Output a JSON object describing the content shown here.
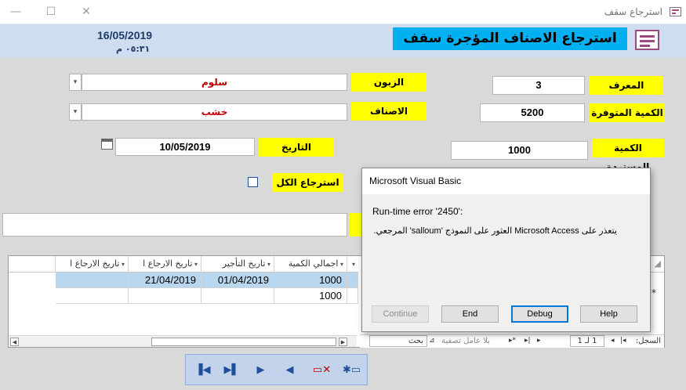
{
  "window": {
    "title": "استرجاع سقف",
    "minimize": "—",
    "maximize": "☐",
    "close": "✕"
  },
  "header": {
    "date": "16/05/2019",
    "time": "٠٥:٣١ م",
    "title": "استرجاع الاصناف المؤجرة سقف"
  },
  "form": {
    "id_label": "المعرف",
    "id_value": "3",
    "available_label": "الكمية المتوفرة",
    "available_value": "5200",
    "returned_label": "الكمية المستردة",
    "returned_value": "1000",
    "customer_label": "الزبون",
    "customer_value": "سلوم",
    "items_label": "الاصناف",
    "items_value": "خشب",
    "date_label": "التاريخ",
    "date_value": "10/05/2019",
    "return_all_label": "استرجاع الكل"
  },
  "sheet": {
    "headers": [
      "تاريخ الارجاع ا",
      "تاريخ الارجاع ا",
      "تاريخ التأجير",
      "اجمالي الكمية"
    ],
    "rows": [
      {
        "c1": "",
        "c2": "21/04/2019",
        "c3": "01/04/2019",
        "c4": "1000"
      },
      {
        "c1": "",
        "c2": "",
        "c3": "",
        "c4": "1000"
      }
    ],
    "new_row_marker": "*",
    "nav_label": "السجل:",
    "nav_position": "1 لـ 1",
    "filter_label": "بلا عامل تصفية",
    "search_label": "بحث"
  },
  "dialog": {
    "title": "Microsoft Visual Basic",
    "line1": "Run-time error '2450':",
    "line2": "يتعذر على Microsoft Access العثور على النموذج 'salloum' المرجعي.",
    "buttons": {
      "continue": "Continue",
      "end": "End",
      "debug": "Debug",
      "help": "Help"
    }
  }
}
